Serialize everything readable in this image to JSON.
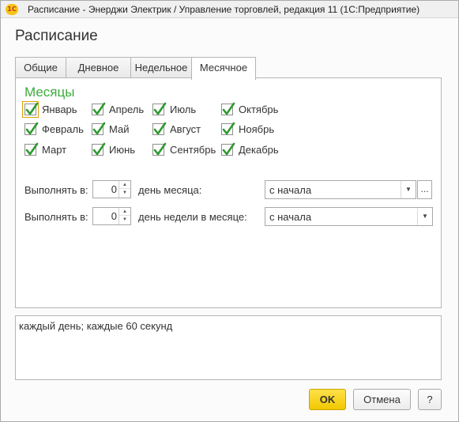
{
  "window": {
    "app_icon": "1С",
    "title": "Расписание - Энерджи Электрик / Управление торговлей, редакция 11  (1С:Предприятие)"
  },
  "form": {
    "title": "Расписание"
  },
  "tabs": [
    {
      "label": "Общие",
      "active": false
    },
    {
      "label": "Дневное",
      "active": false
    },
    {
      "label": "Недельное",
      "active": false
    },
    {
      "label": "Месячное",
      "active": true
    }
  ],
  "months_group": {
    "title": "Месяцы",
    "check_color": "#2e9a2e",
    "months": [
      {
        "label": "Январь",
        "checked": true
      },
      {
        "label": "Февраль",
        "checked": true
      },
      {
        "label": "Март",
        "checked": true
      },
      {
        "label": "Апрель",
        "checked": true
      },
      {
        "label": "Май",
        "checked": true
      },
      {
        "label": "Июнь",
        "checked": true
      },
      {
        "label": "Июль",
        "checked": true
      },
      {
        "label": "Август",
        "checked": true
      },
      {
        "label": "Сентябрь",
        "checked": true
      },
      {
        "label": "Октябрь",
        "checked": true
      },
      {
        "label": "Ноябрь",
        "checked": true
      },
      {
        "label": "Декабрь",
        "checked": true
      }
    ]
  },
  "day_of_month": {
    "label": "Выполнять в:",
    "value": "0",
    "suffix": "день месяца:",
    "select_value": "с начала",
    "ellipsis": "..."
  },
  "day_of_week_in_month": {
    "label": "Выполнять в:",
    "value": "0",
    "suffix": "день недели в месяце:",
    "select_value": "с начала"
  },
  "summary": {
    "text": "каждый день; каждые 60 секунд"
  },
  "buttons": {
    "ok": "OK",
    "cancel": "Отмена",
    "help": "?"
  },
  "colors": {
    "accent_green": "#3cab3c",
    "ok_button": "#f2c800"
  }
}
